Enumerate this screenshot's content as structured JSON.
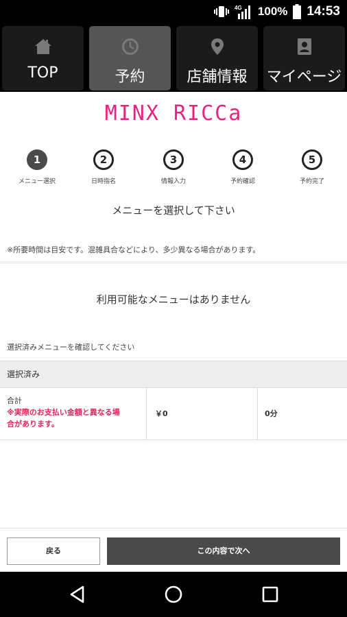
{
  "status_bar": {
    "network_label": "4G",
    "battery_text": "100%",
    "time": "14:53"
  },
  "nav": {
    "tabs": [
      {
        "label": "TOP",
        "icon": "home-icon",
        "active": false
      },
      {
        "label": "予約",
        "icon": "clock-icon",
        "active": true
      },
      {
        "label": "店舗情報",
        "icon": "map-pin-icon",
        "active": false
      },
      {
        "label": "マイページ",
        "icon": "user-card-icon",
        "active": false
      }
    ]
  },
  "logo_text": "MINX RICCa",
  "steps": [
    {
      "number": "1",
      "label": "メニュー選択",
      "active": true
    },
    {
      "number": "2",
      "label": "日時指名",
      "active": false
    },
    {
      "number": "3",
      "label": "情報入力",
      "active": false
    },
    {
      "number": "4",
      "label": "予約確認",
      "active": false
    },
    {
      "number": "5",
      "label": "予約完了",
      "active": false
    }
  ],
  "instruction": "メニューを選択して下さい",
  "note": "※所要時間は目安です。混雑具合などにより、多少異なる場合があります。",
  "no_menu": "利用可能なメニューはありません",
  "confirm_text": "選択済みメニューを確認してください",
  "selected": {
    "header": "選択済み",
    "total_label": "合計",
    "warning_line1": "※実際のお支払い金額と異なる場",
    "warning_line2": "合があります。",
    "price": "￥0",
    "duration": "0分"
  },
  "buttons": {
    "back": "戻る",
    "next": "この内容で次へ"
  },
  "colors": {
    "brand": "#e8237f",
    "warning": "#e8235a",
    "active_tab": "#555555",
    "primary_button": "#4a4a4a"
  }
}
